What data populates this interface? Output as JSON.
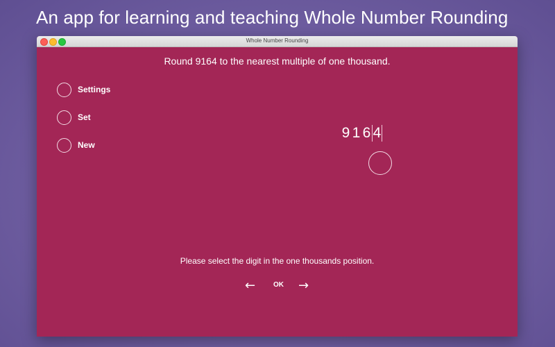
{
  "headline": "An app for learning and teaching Whole Number Rounding",
  "window": {
    "title": "Whole Number Rounding"
  },
  "question": "Round 9164 to the nearest multiple of one thousand.",
  "menu": [
    {
      "label": "Settings"
    },
    {
      "label": "Set"
    },
    {
      "label": "New"
    }
  ],
  "number": {
    "digits": [
      "9",
      "1",
      "6",
      "4"
    ]
  },
  "prompt": "Please select the digit in the one thousands position.",
  "nav": {
    "back": "←",
    "ok": "OK",
    "forward": "→"
  },
  "colors": {
    "window_bg": "#a32656",
    "desktop_bg": "#6f5ea1"
  },
  "icons": {
    "back": "left-arrow-icon",
    "forward": "right-arrow-icon"
  }
}
